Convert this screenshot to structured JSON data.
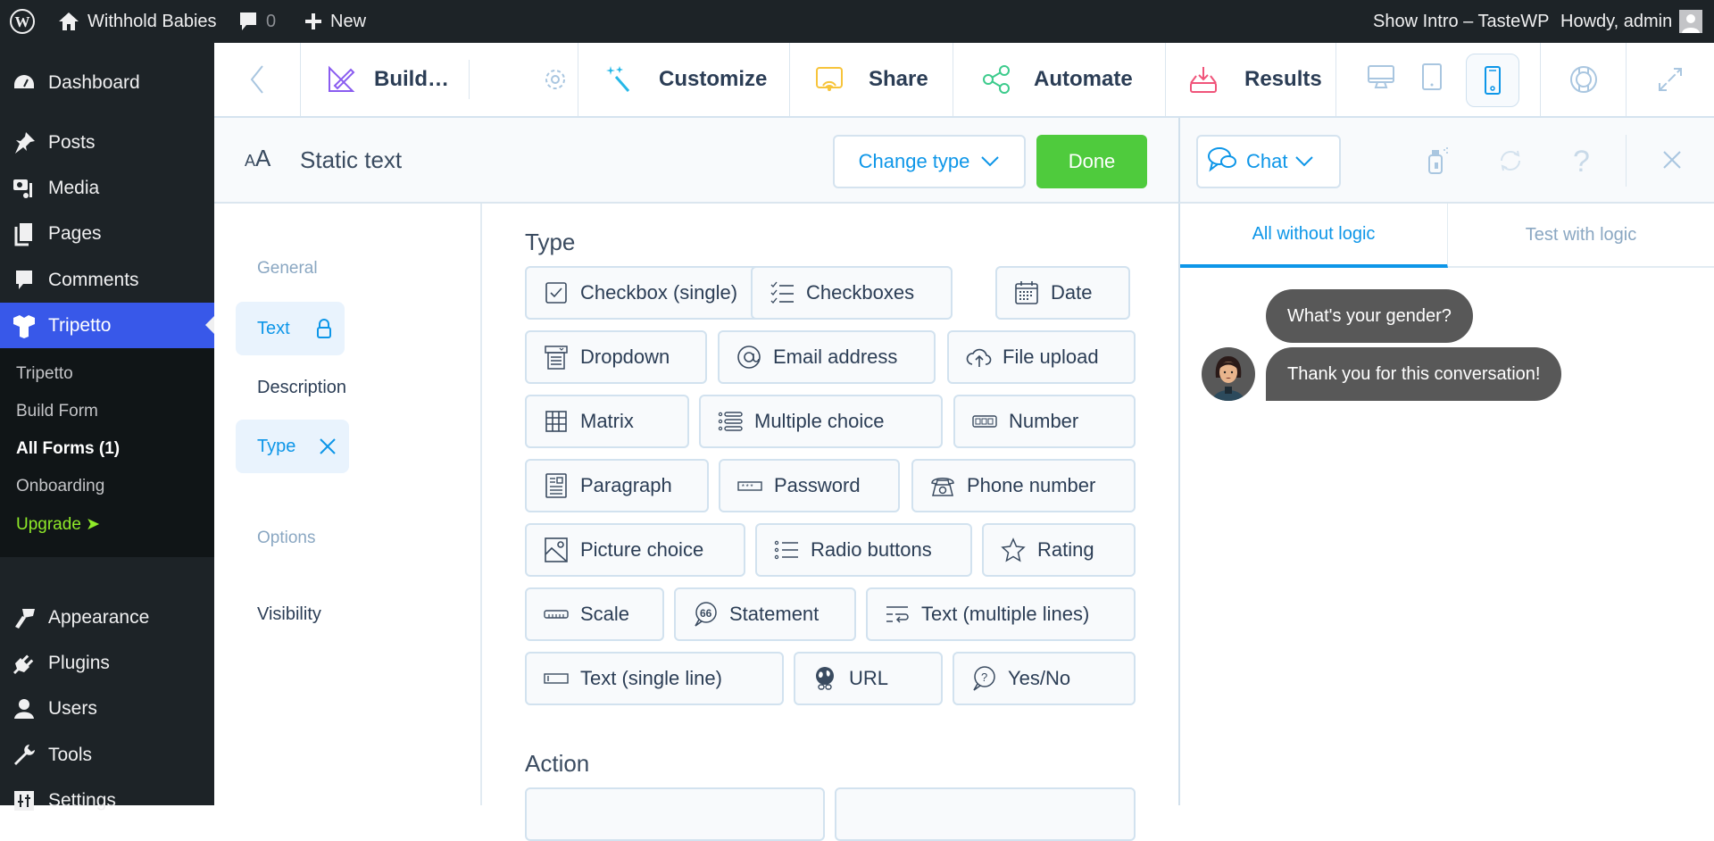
{
  "admin_bar": {
    "wp_logo": "wordpress-logo-icon",
    "site_name": "Withhold Babies",
    "comments_count": "0",
    "new_label": "New",
    "show_intro": "Show Intro – TasteWP",
    "howdy": "Howdy, admin"
  },
  "sidebar": {
    "items": [
      {
        "label": "Dashboard",
        "icon": "dashboard-icon"
      },
      {
        "label": "Posts",
        "icon": "pin-icon"
      },
      {
        "label": "Media",
        "icon": "media-icon"
      },
      {
        "label": "Pages",
        "icon": "pages-icon"
      },
      {
        "label": "Comments",
        "icon": "comment-icon"
      },
      {
        "label": "Tripetto",
        "icon": "tripetto-icon",
        "active": true
      },
      {
        "label": "Appearance",
        "icon": "paintbrush-icon"
      },
      {
        "label": "Plugins",
        "icon": "plug-icon"
      },
      {
        "label": "Users",
        "icon": "user-icon"
      },
      {
        "label": "Tools",
        "icon": "wrench-icon"
      },
      {
        "label": "Settings",
        "icon": "settings-icon"
      }
    ],
    "submenu": [
      {
        "label": "Tripetto"
      },
      {
        "label": "Build Form"
      },
      {
        "label": "All Forms (1)",
        "current": true
      },
      {
        "label": "Onboarding"
      },
      {
        "label": "Upgrade ➤",
        "highlight": true
      }
    ]
  },
  "toolbar": {
    "build": "Build…",
    "customize": "Customize",
    "share": "Share",
    "automate": "Automate",
    "results": "Results",
    "devices": [
      "desktop",
      "tablet",
      "phone"
    ],
    "active_device": "phone"
  },
  "editor": {
    "block_type": "Static text",
    "change_type": "Change type",
    "done": "Done",
    "nav": {
      "general_title": "General",
      "text": "Text",
      "description": "Description",
      "type": "Type",
      "options_title": "Options",
      "visibility": "Visibility"
    },
    "type_title": "Type",
    "action_title": "Action",
    "types": [
      {
        "label": "Checkbox (single)",
        "icon": "checkbox-icon"
      },
      {
        "label": "Checkboxes",
        "icon": "checklist-icon"
      },
      {
        "label": "Date",
        "icon": "calendar-icon"
      },
      {
        "label": "Dropdown",
        "icon": "dropdown-icon"
      },
      {
        "label": "Email address",
        "icon": "at-icon"
      },
      {
        "label": "File upload",
        "icon": "cloud-upload-icon"
      },
      {
        "label": "Matrix",
        "icon": "grid-icon"
      },
      {
        "label": "Multiple choice",
        "icon": "list-icon"
      },
      {
        "label": "Number",
        "icon": "number-icon"
      },
      {
        "label": "Paragraph",
        "icon": "paragraph-icon"
      },
      {
        "label": "Password",
        "icon": "password-icon"
      },
      {
        "label": "Phone number",
        "icon": "phone-icon"
      },
      {
        "label": "Picture choice",
        "icon": "picture-icon"
      },
      {
        "label": "Radio buttons",
        "icon": "radio-list-icon"
      },
      {
        "label": "Rating",
        "icon": "star-icon"
      },
      {
        "label": "Scale",
        "icon": "ruler-icon"
      },
      {
        "label": "Statement",
        "icon": "quote-icon"
      },
      {
        "label": "Text (multiple lines)",
        "icon": "multiline-icon"
      },
      {
        "label": "Text (single line)",
        "icon": "text-input-icon"
      },
      {
        "label": "URL",
        "icon": "globe-link-icon"
      },
      {
        "label": "Yes/No",
        "icon": "question-bubble-icon"
      }
    ]
  },
  "preview": {
    "mode": "Chat",
    "tabs": [
      {
        "label": "All without logic",
        "active": true
      },
      {
        "label": "Test with logic",
        "active": false
      }
    ],
    "messages": [
      "What's your gender?",
      "Thank you for this conversation!"
    ]
  },
  "colors": {
    "accent": "#0d96e8",
    "done_green": "#4fcb3d",
    "wp_active": "#3858e9",
    "bubble": "#585858"
  }
}
